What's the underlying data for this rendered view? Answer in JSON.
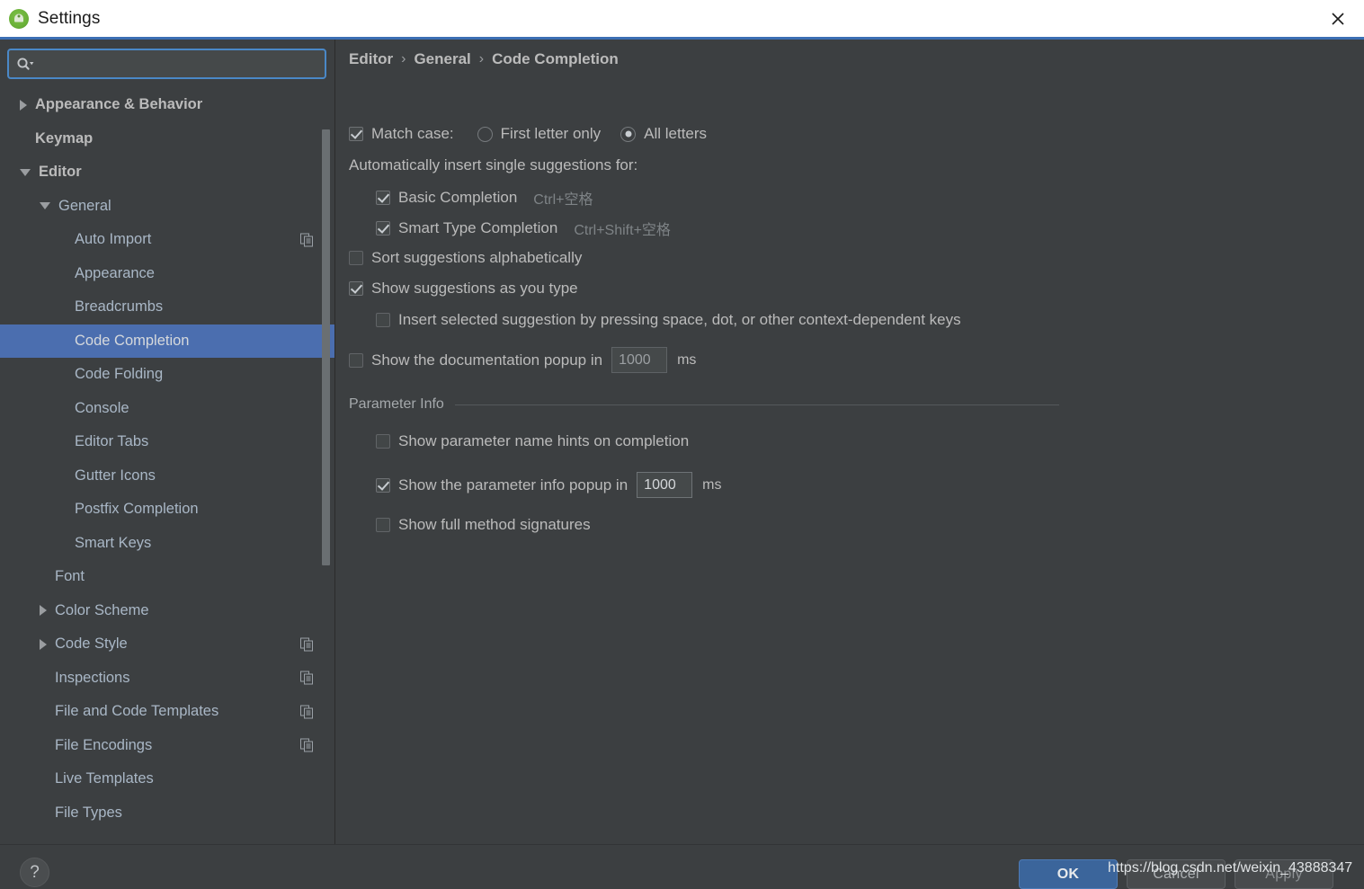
{
  "window": {
    "title": "Settings",
    "app_icon": "android-studio-icon",
    "close_icon": "close-icon",
    "accent_color": "#3c6fb4",
    "background_color": "#3c3f41",
    "selection_color": "#4b6eaf"
  },
  "sidebar": {
    "search": {
      "icon": "search-icon",
      "value": "",
      "placeholder": ""
    },
    "items": [
      {
        "label": "Appearance & Behavior",
        "indent": 0,
        "twisty": "collapsed",
        "bold": true,
        "selected": false,
        "copy_icon": false
      },
      {
        "label": "Keymap",
        "indent": 0,
        "twisty": "none",
        "bold": true,
        "selected": false,
        "copy_icon": false
      },
      {
        "label": "Editor",
        "indent": 0,
        "twisty": "expanded",
        "bold": true,
        "selected": false,
        "copy_icon": false
      },
      {
        "label": "General",
        "indent": 1,
        "twisty": "expanded",
        "bold": false,
        "selected": false,
        "copy_icon": false
      },
      {
        "label": "Auto Import",
        "indent": 2,
        "twisty": "none",
        "bold": false,
        "selected": false,
        "copy_icon": true
      },
      {
        "label": "Appearance",
        "indent": 2,
        "twisty": "none",
        "bold": false,
        "selected": false,
        "copy_icon": false
      },
      {
        "label": "Breadcrumbs",
        "indent": 2,
        "twisty": "none",
        "bold": false,
        "selected": false,
        "copy_icon": false
      },
      {
        "label": "Code Completion",
        "indent": 2,
        "twisty": "none",
        "bold": false,
        "selected": true,
        "copy_icon": false
      },
      {
        "label": "Code Folding",
        "indent": 2,
        "twisty": "none",
        "bold": false,
        "selected": false,
        "copy_icon": false
      },
      {
        "label": "Console",
        "indent": 2,
        "twisty": "none",
        "bold": false,
        "selected": false,
        "copy_icon": false
      },
      {
        "label": "Editor Tabs",
        "indent": 2,
        "twisty": "none",
        "bold": false,
        "selected": false,
        "copy_icon": false
      },
      {
        "label": "Gutter Icons",
        "indent": 2,
        "twisty": "none",
        "bold": false,
        "selected": false,
        "copy_icon": false
      },
      {
        "label": "Postfix Completion",
        "indent": 2,
        "twisty": "none",
        "bold": false,
        "selected": false,
        "copy_icon": false
      },
      {
        "label": "Smart Keys",
        "indent": 2,
        "twisty": "none",
        "bold": false,
        "selected": false,
        "copy_icon": false
      },
      {
        "label": "Font",
        "indent": 1,
        "twisty": "none",
        "bold": false,
        "selected": false,
        "copy_icon": false
      },
      {
        "label": "Color Scheme",
        "indent": 1,
        "twisty": "collapsed",
        "bold": false,
        "selected": false,
        "copy_icon": false
      },
      {
        "label": "Code Style",
        "indent": 1,
        "twisty": "collapsed",
        "bold": false,
        "selected": false,
        "copy_icon": true
      },
      {
        "label": "Inspections",
        "indent": 1,
        "twisty": "none",
        "bold": false,
        "selected": false,
        "copy_icon": true
      },
      {
        "label": "File and Code Templates",
        "indent": 1,
        "twisty": "none",
        "bold": false,
        "selected": false,
        "copy_icon": true
      },
      {
        "label": "File Encodings",
        "indent": 1,
        "twisty": "none",
        "bold": false,
        "selected": false,
        "copy_icon": true
      },
      {
        "label": "Live Templates",
        "indent": 1,
        "twisty": "none",
        "bold": false,
        "selected": false,
        "copy_icon": false
      },
      {
        "label": "File Types",
        "indent": 1,
        "twisty": "none",
        "bold": false,
        "selected": false,
        "copy_icon": false
      }
    ]
  },
  "main": {
    "breadcrumb": [
      "Editor",
      "General",
      "Code Completion"
    ],
    "breadcrumb_separator": "›",
    "match_case": {
      "label": "Match case:",
      "checked": true,
      "options": [
        {
          "label": "First letter only",
          "selected": false
        },
        {
          "label": "All letters",
          "selected": true
        }
      ]
    },
    "auto_insert_header": "Automatically insert single suggestions for:",
    "auto_insert": [
      {
        "label": "Basic Completion",
        "shortcut": "Ctrl+空格",
        "checked": true
      },
      {
        "label": "Smart Type Completion",
        "shortcut": "Ctrl+Shift+空格",
        "checked": true
      }
    ],
    "sort_alphabetically": {
      "label": "Sort suggestions alphabetically",
      "checked": false
    },
    "show_as_you_type": {
      "label": "Show suggestions as you type",
      "checked": true
    },
    "insert_on_keys": {
      "label": "Insert selected suggestion by pressing space, dot, or other context-dependent keys",
      "checked": false
    },
    "doc_popup": {
      "label": "Show the documentation popup in",
      "checked": false,
      "value": "1000",
      "unit": "ms",
      "enabled": false
    },
    "parameter_info": {
      "section_title": "Parameter Info",
      "name_hints": {
        "label": "Show parameter name hints on completion",
        "checked": false
      },
      "popup": {
        "label": "Show the parameter info popup in",
        "checked": true,
        "value": "1000",
        "unit": "ms",
        "enabled": true
      },
      "full_signatures": {
        "label": "Show full method signatures",
        "checked": false
      }
    }
  },
  "footer": {
    "help_label": "?",
    "ok_label": "OK",
    "cancel_label": "Cancel",
    "apply_label": "Apply",
    "watermark": "https://blog.csdn.net/weixin_43888347"
  }
}
